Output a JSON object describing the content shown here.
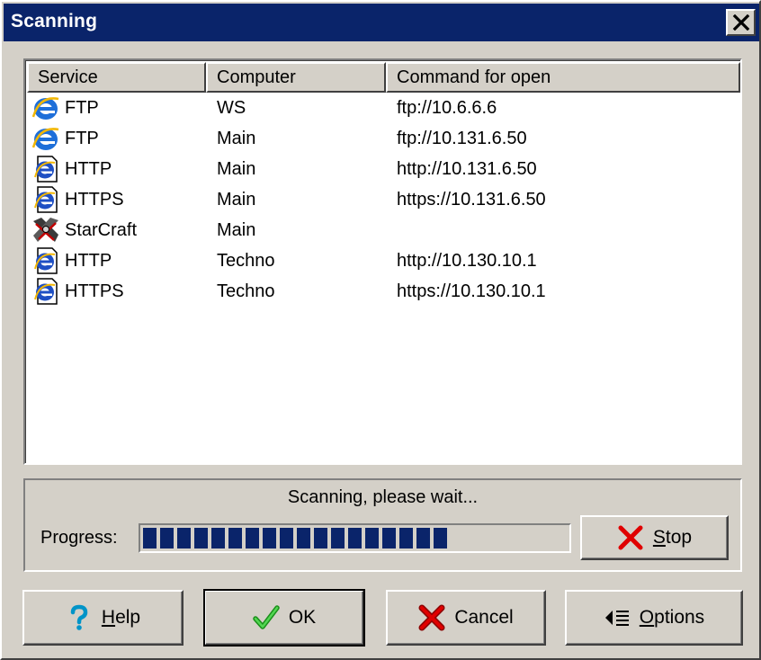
{
  "window": {
    "title": "Scanning",
    "close_glyph": "✕",
    "title_bar_color": "#0a246a"
  },
  "list": {
    "columns": [
      "Service",
      "Computer",
      "Command for open"
    ],
    "rows": [
      {
        "icon": "ie-icon",
        "service": "FTP",
        "computer": "WS",
        "command": "ftp://10.6.6.6"
      },
      {
        "icon": "ie-icon",
        "service": "FTP",
        "computer": "Main",
        "command": "ftp://10.131.6.50"
      },
      {
        "icon": "html-document-icon",
        "service": "HTTP",
        "computer": "Main",
        "command": "http://10.131.6.50"
      },
      {
        "icon": "html-document-icon",
        "service": "HTTPS",
        "computer": "Main",
        "command": "https://10.131.6.50"
      },
      {
        "icon": "starcraft-icon",
        "service": "StarCraft",
        "computer": "Main",
        "command": ""
      },
      {
        "icon": "html-document-icon",
        "service": "HTTP",
        "computer": "Techno",
        "command": "http://10.130.10.1"
      },
      {
        "icon": "html-document-icon",
        "service": "HTTPS",
        "computer": "Techno",
        "command": "https://10.130.10.1"
      }
    ]
  },
  "progress": {
    "status": "Scanning, please wait...",
    "label": "Progress:",
    "fraction": 0.72,
    "stop_label_prefix": "",
    "stop_label_underlined": "S",
    "stop_label_rest": "top"
  },
  "buttons": {
    "help": {
      "underlined": "H",
      "rest": "elp"
    },
    "ok": {
      "text": "OK"
    },
    "cancel": {
      "text": "Cancel"
    },
    "options": {
      "underlined": "O",
      "rest": "ptions"
    }
  }
}
